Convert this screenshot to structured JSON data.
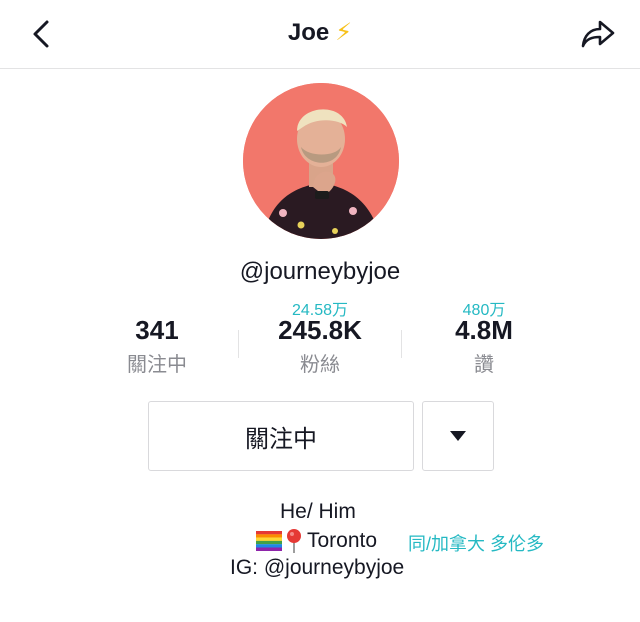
{
  "header": {
    "title": "Joe",
    "title_emoji": "⚡",
    "back_icon": "chevron-left-icon",
    "share_icon": "share-arrow-icon"
  },
  "profile": {
    "username": "@journeybyjoe"
  },
  "stats": [
    {
      "hint": "",
      "value": "341",
      "label": "關注中"
    },
    {
      "hint": "24.58万",
      "value": "245.8K",
      "label": "粉絲"
    },
    {
      "hint": "480万",
      "value": "4.8M",
      "label": "讚"
    }
  ],
  "actions": {
    "follow_label": "關注中",
    "dropdown_icon": "caret-down-icon"
  },
  "bio": {
    "line1": "He/ Him",
    "line2_text": "Toronto",
    "line2_icons": [
      "rainbow-flag-icon",
      "map-pin-icon"
    ],
    "translation": "同/加拿大 多伦多",
    "line3": "IG: @journeybyjoe"
  },
  "colors": {
    "accent": "#25b9c3",
    "text": "#161823",
    "secondary": "#8a8b91",
    "avatar_bg": "#f2776b"
  }
}
